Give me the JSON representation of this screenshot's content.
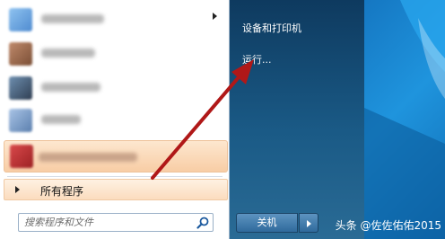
{
  "start_menu": {
    "all_programs_label": "所有程序",
    "search": {
      "placeholder": "搜索程序和文件"
    },
    "right_links": {
      "devices_printers": "设备和打印机",
      "run": "运行..."
    },
    "shutdown_label": "关机"
  },
  "watermark": "头条 @佐佐佑佑2015",
  "colors": {
    "arrow": "#b01818",
    "right_pane": "#1a5a86",
    "highlight": "#f8cda5"
  },
  "icons": {
    "search": "search-icon",
    "submenu": "chevron-right-icon",
    "shutdown_options": "chevron-right-icon"
  }
}
